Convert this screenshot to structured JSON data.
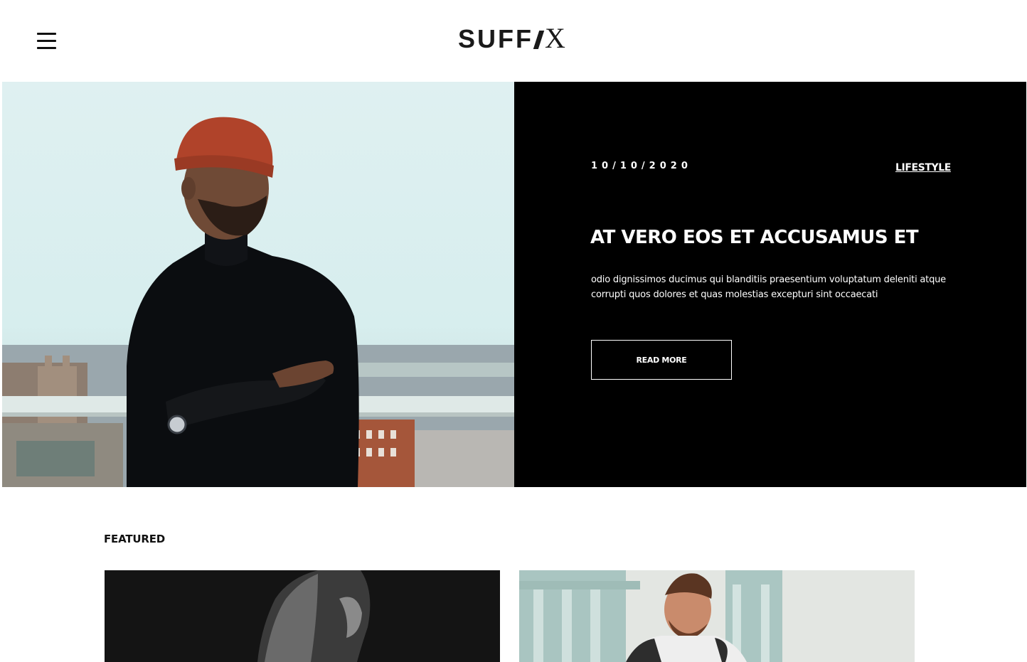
{
  "header": {
    "logo_main": "SUFF",
    "logo_x": "X",
    "menu_icon": "hamburger-menu-icon"
  },
  "hero": {
    "date": "10/10/2020",
    "category": "LIFESTYLE",
    "title": "AT VERO EOS ET ACCUSAMUS ET",
    "excerpt": "odio dignissimos ducimus qui blanditiis praesentium voluptatum deleniti atque corrupti quos dolores et quas molestias excepturi sint occaecati",
    "button_label": "READ MORE",
    "panel_color": "#000000",
    "text_color": "#ffffff"
  },
  "featured": {
    "label": "FEATURED",
    "cards": [
      {
        "image": "man-profile-black-and-white"
      },
      {
        "image": "smiling-man-raglan-shirt"
      }
    ]
  }
}
